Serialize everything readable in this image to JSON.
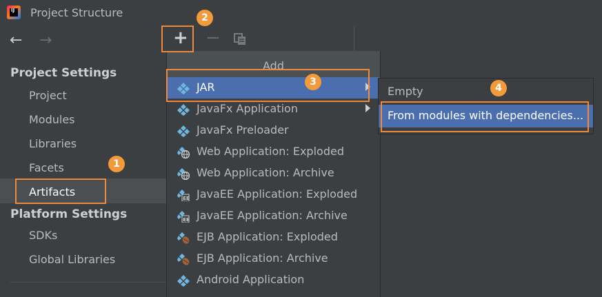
{
  "window": {
    "title": "Project Structure",
    "app_icon_letters": "IJ"
  },
  "nav": {
    "back": "←",
    "forward": "→"
  },
  "sidebar": {
    "project_settings_heading": "Project Settings",
    "project_items": [
      "Project",
      "Modules",
      "Libraries",
      "Facets",
      "Artifacts"
    ],
    "platform_settings_heading": "Platform Settings",
    "platform_items": [
      "SDKs",
      "Global Libraries"
    ],
    "selected": "Artifacts"
  },
  "toolbar": {
    "add": "+",
    "remove": "−"
  },
  "add_menu": {
    "header": "Add",
    "items": [
      {
        "label": "JAR",
        "icon": "artifact-icon",
        "submenu": true,
        "active": true
      },
      {
        "label": "JavaFx Application",
        "icon": "artifact-icon",
        "submenu": true
      },
      {
        "label": "JavaFx Preloader",
        "icon": "artifact-icon"
      },
      {
        "label": "Web Application: Exploded",
        "icon": "web-artifact-icon"
      },
      {
        "label": "Web Application: Archive",
        "icon": "web-artifact-icon"
      },
      {
        "label": "JavaEE Application: Exploded",
        "icon": "javaee-artifact-icon"
      },
      {
        "label": "JavaEE Application: Archive",
        "icon": "javaee-artifact-icon"
      },
      {
        "label": "EJB Application: Exploded",
        "icon": "ejb-artifact-icon"
      },
      {
        "label": "EJB Application: Archive",
        "icon": "ejb-artifact-icon"
      },
      {
        "label": "Android Application",
        "icon": "artifact-icon"
      }
    ]
  },
  "jar_submenu": {
    "items": [
      "Empty",
      "From modules with dependencies..."
    ]
  },
  "annotations": {
    "step1": "1",
    "step2": "2",
    "step3": "3",
    "step4": "4"
  },
  "colors": {
    "accent_selection": "#4b6eaf",
    "callout": "#f39a3a",
    "highlight_border": "#f0883e",
    "background": "#3c3f41"
  }
}
